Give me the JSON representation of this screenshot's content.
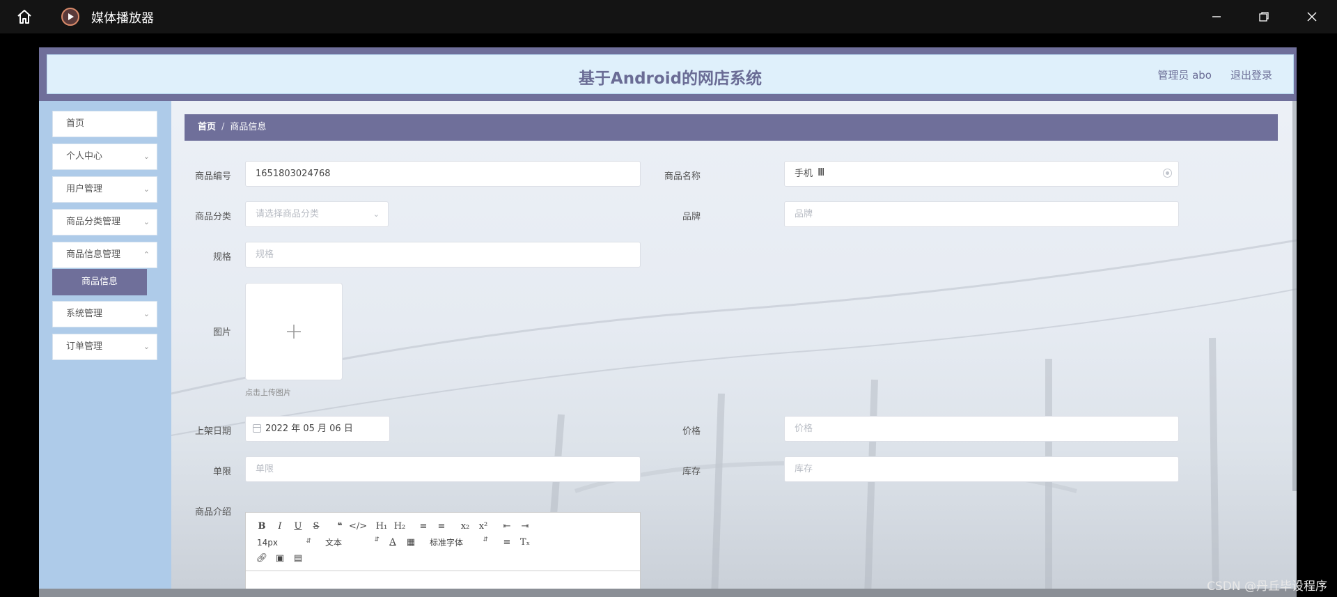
{
  "window": {
    "title": "媒体播放器"
  },
  "header": {
    "app_title": "基于Android的网店系统",
    "user": "管理员 abo",
    "logout": "退出登录"
  },
  "sidebar": {
    "items": [
      {
        "label": "首页"
      },
      {
        "label": "个人中心"
      },
      {
        "label": "用户管理"
      },
      {
        "label": "商品分类管理"
      },
      {
        "label": "商品信息管理"
      },
      {
        "label": "系统管理"
      },
      {
        "label": "订单管理"
      }
    ],
    "active_sub": "商品信息"
  },
  "breadcrumb": {
    "home": "首页",
    "separator": "/",
    "current": "商品信息"
  },
  "form": {
    "code_label": "商品编号",
    "code_value": "1651803024768",
    "name_label": "商品名称",
    "name_value": "手机",
    "category_label": "商品分类",
    "category_placeholder": "请选择商品分类",
    "brand_label": "品牌",
    "brand_placeholder": "品牌",
    "spec_label": "规格",
    "spec_placeholder": "规格",
    "image_label": "图片",
    "image_hint": "点击上传图片",
    "date_label": "上架日期",
    "date_value": "2022 年 05 月 06 日",
    "price_label": "价格",
    "price_placeholder": "价格",
    "limit_label": "单限",
    "limit_placeholder": "单限",
    "stock_label": "库存",
    "stock_placeholder": "库存",
    "intro_label": "商品介绍"
  },
  "editor": {
    "size": "14px",
    "text": "文本",
    "font": "标准字体"
  },
  "watermark": "CSDN @丹丘毕设程序",
  "colors": {
    "accent": "#6f6f9a",
    "sidebar": "#aecbe9",
    "header_bg": "#dff0fb"
  }
}
